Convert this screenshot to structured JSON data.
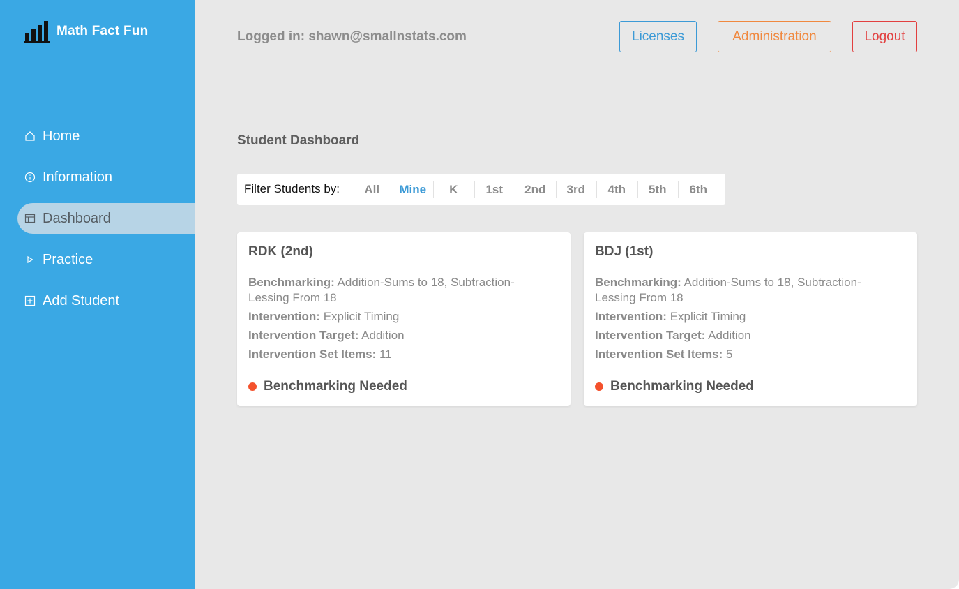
{
  "app": {
    "title": "Math Fact Fun"
  },
  "sidebar": {
    "items": [
      {
        "label": "Home",
        "icon": "home-icon"
      },
      {
        "label": "Information",
        "icon": "info-icon"
      },
      {
        "label": "Dashboard",
        "icon": "dashboard-icon",
        "active": true
      },
      {
        "label": "Practice",
        "icon": "play-icon"
      },
      {
        "label": "Add Student",
        "icon": "add-icon"
      }
    ]
  },
  "header": {
    "logged_in": "Logged in: shawn@smallnstats.com",
    "licenses_label": "Licenses",
    "administration_label": "Administration",
    "logout_label": "Logout"
  },
  "main": {
    "title": "Student Dashboard",
    "filter": {
      "label": "Filter Students by:",
      "options": [
        "All",
        "Mine",
        "K",
        "1st",
        "2nd",
        "3rd",
        "4th",
        "5th",
        "6th"
      ],
      "selected": "Mine"
    },
    "cards": [
      {
        "name": "RDK (2nd)",
        "benchmarking_label": "Benchmarking:",
        "benchmarking": "Addition-Sums to 18, Subtraction-Lessing From 18",
        "intervention_label": "Intervention:",
        "intervention": "Explicit Timing",
        "target_label": "Intervention Target:",
        "target": "Addition",
        "items_label": "Intervention Set Items:",
        "items": "11",
        "status": "Benchmarking Needed"
      },
      {
        "name": "BDJ (1st)",
        "benchmarking_label": "Benchmarking:",
        "benchmarking": "Addition-Sums to 18, Subtraction-Lessing From 18",
        "intervention_label": "Intervention:",
        "intervention": "Explicit Timing",
        "target_label": "Intervention Target:",
        "target": "Addition",
        "items_label": "Intervention Set Items:",
        "items": "5",
        "status": "Benchmarking Needed"
      }
    ]
  },
  "colors": {
    "sidebar": "#3aa8e4",
    "background": "#e8e8e8",
    "licenses": "#3c9ad6",
    "administration": "#f0883e",
    "logout": "#e24040",
    "status_dot": "#f4512c",
    "filter_selected": "#3c9ad6"
  }
}
